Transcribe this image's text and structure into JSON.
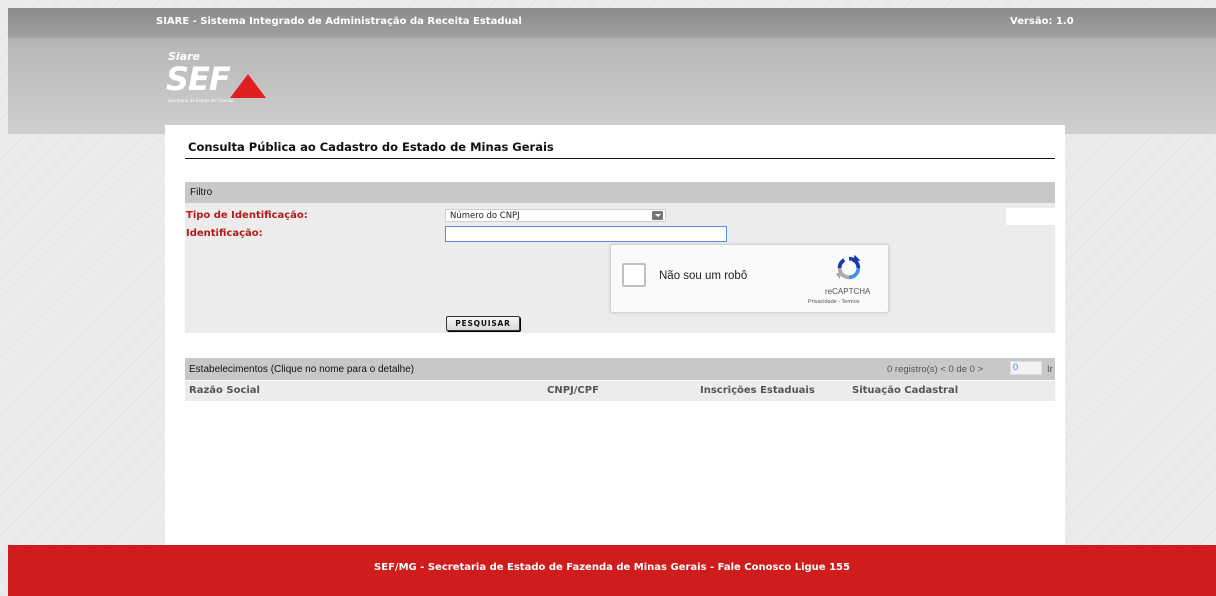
{
  "header": {
    "system_title": "SIARE - Sistema Integrado de Administração da Receita Estadual",
    "version": "Versão: 1.0",
    "logo": {
      "top_text": "Siare",
      "main_text": "SEF",
      "subtitle": "Secretaria de Estado de Fazenda"
    }
  },
  "page": {
    "title": "Consulta Pública ao Cadastro do Estado de Minas Gerais"
  },
  "filter": {
    "heading": "Filtro",
    "tipo_label": "Tipo de Identificação:",
    "tipo_value": "Número do CNPJ",
    "identificacao_label": "Identificação:",
    "identificacao_value": "",
    "captcha": {
      "label": "Não sou um robô",
      "brand": "reCAPTCHA",
      "links": "Privacidade - Termos"
    },
    "search_button": "PESQUISAR"
  },
  "results": {
    "heading": "Estabelecimentos (Clique no nome para o detalhe)",
    "pager_text": "0 registro(s) < 0 de 0 >",
    "page_input": "0",
    "go_label": "Ir",
    "columns": [
      "Razão Social",
      "CNPJ/CPF",
      "Inscrições Estaduais",
      "Situação Cadastral"
    ]
  },
  "footer": {
    "text": "SEF/MG - Secretaria de Estado de Fazenda de Minas Gerais - Fale Conosco Ligue 155"
  },
  "colors": {
    "brand_red": "#cf1c1c",
    "label_red": "#b31a1a",
    "header_gray": "#9b9b9b"
  }
}
